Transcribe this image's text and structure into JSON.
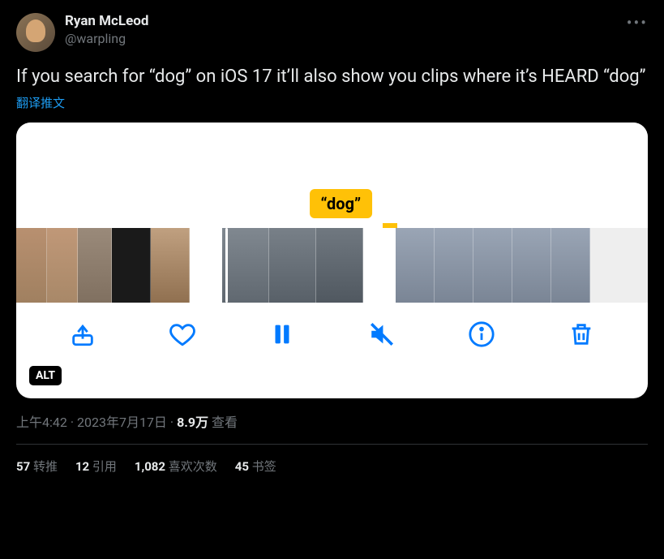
{
  "user": {
    "name": "Ryan McLeod",
    "handle": "@warpling"
  },
  "content": "If you search for “dog” on iOS 17 it’ll also show you clips where it’s HEARD “dog”",
  "translate": "翻译推文",
  "media": {
    "label": "“dog”",
    "alt_badge": "ALT",
    "toolbar": {
      "share": "share-icon",
      "like": "heart-icon",
      "pause": "pause-icon",
      "mute": "mute-icon",
      "info": "info-icon",
      "trash": "trash-icon"
    }
  },
  "meta": {
    "time": "上午4:42",
    "sep1": " · ",
    "date": "2023年7月17日",
    "sep2": " · ",
    "views_num": "8.9万",
    "views_label": " 查看"
  },
  "stats": {
    "retweets_num": "57",
    "retweets_label": " 转推",
    "quotes_num": "12",
    "quotes_label": " 引用",
    "likes_num": "1,082",
    "likes_label": " 喜欢次数",
    "bookmarks_num": "45",
    "bookmarks_label": " 书签"
  }
}
